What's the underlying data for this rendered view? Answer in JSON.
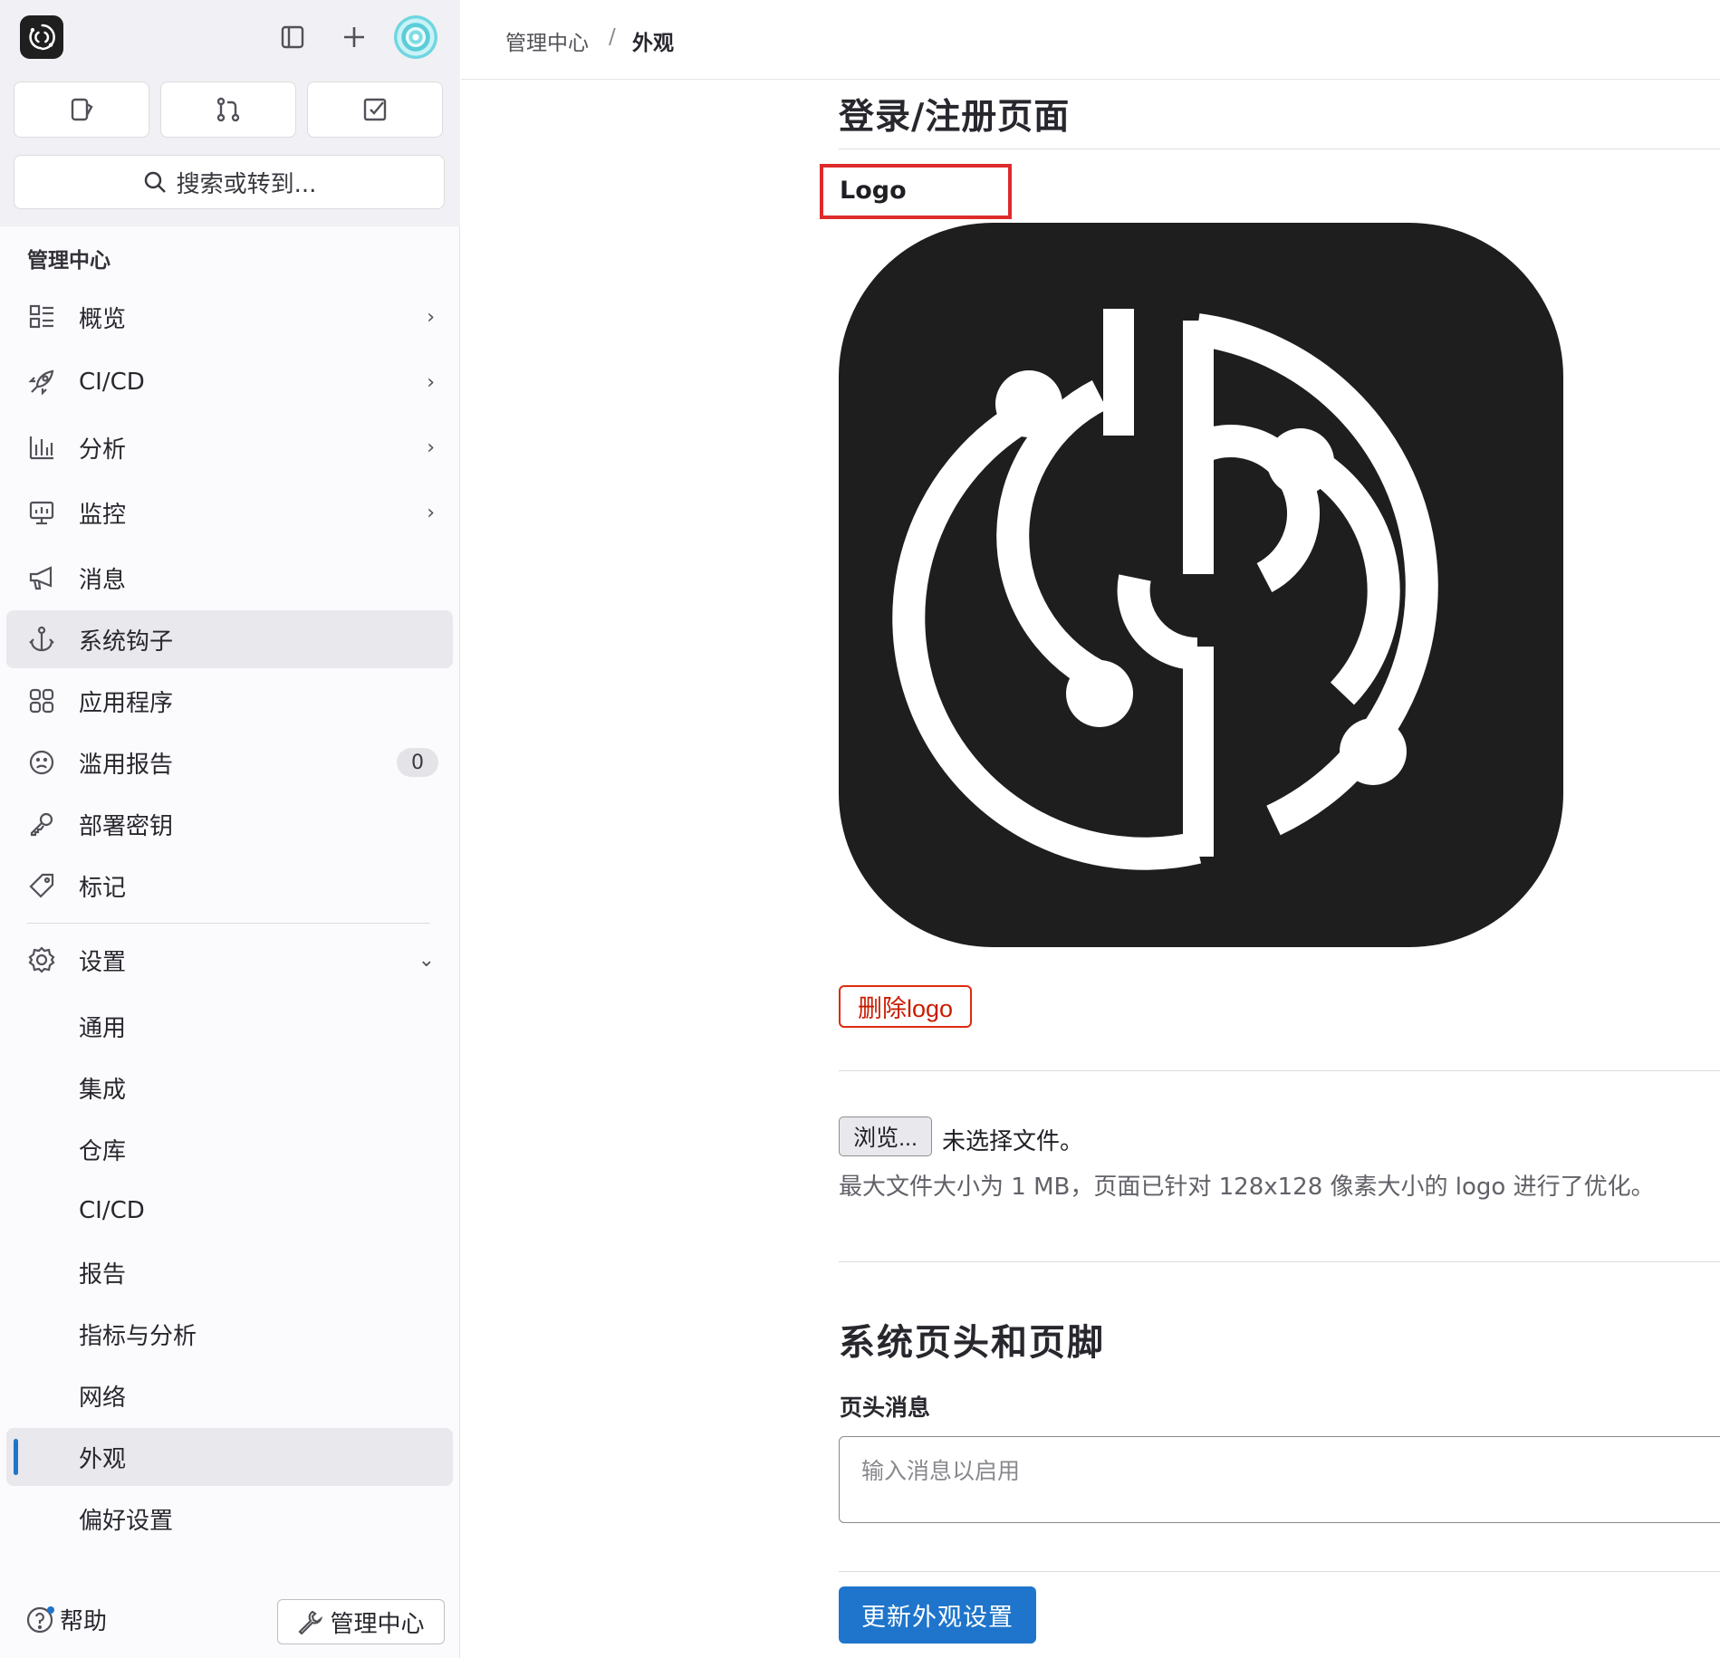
{
  "sidebar": {
    "section_title": "管理中心",
    "search_label": "搜索或转到...",
    "items": [
      {
        "label": "概览"
      },
      {
        "label": "CI/CD"
      },
      {
        "label": "分析"
      },
      {
        "label": "监控"
      },
      {
        "label": "消息"
      },
      {
        "label": "系统钩子"
      },
      {
        "label": "应用程序"
      },
      {
        "label": "滥用报告",
        "badge": "0"
      },
      {
        "label": "部署密钥"
      },
      {
        "label": "标记"
      },
      {
        "label": "设置"
      }
    ],
    "settings_sub": [
      {
        "label": "通用"
      },
      {
        "label": "集成"
      },
      {
        "label": "仓库"
      },
      {
        "label": "CI/CD"
      },
      {
        "label": "报告"
      },
      {
        "label": "指标与分析"
      },
      {
        "label": "网络"
      },
      {
        "label": "外观"
      },
      {
        "label": "偏好设置"
      }
    ],
    "help_label": "帮助",
    "admin_button_label": "管理中心"
  },
  "breadcrumb": {
    "parent": "管理中心",
    "separator": "/",
    "current": "外观"
  },
  "main": {
    "section_title": "登录/注册页面",
    "logo_label": "Logo",
    "delete_logo_label": "删除logo",
    "browse_label": "浏览...",
    "file_status": "未选择文件。",
    "help_text": "最大文件大小为 1 MB，页面已针对 128x128 像素大小的 logo 进行了优化。",
    "header_footer_title": "系统页头和页脚",
    "header_message_label": "页头消息",
    "header_message_placeholder": "输入消息以启用",
    "submit_label": "更新外观设置"
  },
  "colors": {
    "accent": "#1f75cb",
    "danger": "#dd2b0e",
    "highlight_box": "#dd2b2b",
    "logo_bg": "#1e1e1e"
  }
}
